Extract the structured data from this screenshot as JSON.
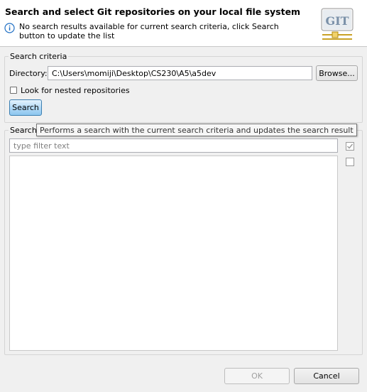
{
  "header": {
    "title": "Search and select Git repositories on your local file system",
    "message": "No search results available for current search criteria, click Search button to update the list",
    "logo_text": "GIT"
  },
  "search_criteria": {
    "legend": "Search criteria",
    "directory_label": "Directory:",
    "directory_value": "C:\\Users\\momiji\\Desktop\\CS230\\A5\\a5dev",
    "browse_label": "Browse...",
    "nested_label": "Look for nested repositories",
    "nested_checked": false,
    "search_label": "Search"
  },
  "results": {
    "legend": "Search",
    "filter_placeholder": "type filter text",
    "items": []
  },
  "tooltip": {
    "text": "Performs a search with the current search criteria and updates the search result"
  },
  "footer": {
    "ok_label": "OK",
    "cancel_label": "Cancel"
  },
  "colors": {
    "accent": "#8dc6ef",
    "info_blue": "#1f6fc4"
  }
}
